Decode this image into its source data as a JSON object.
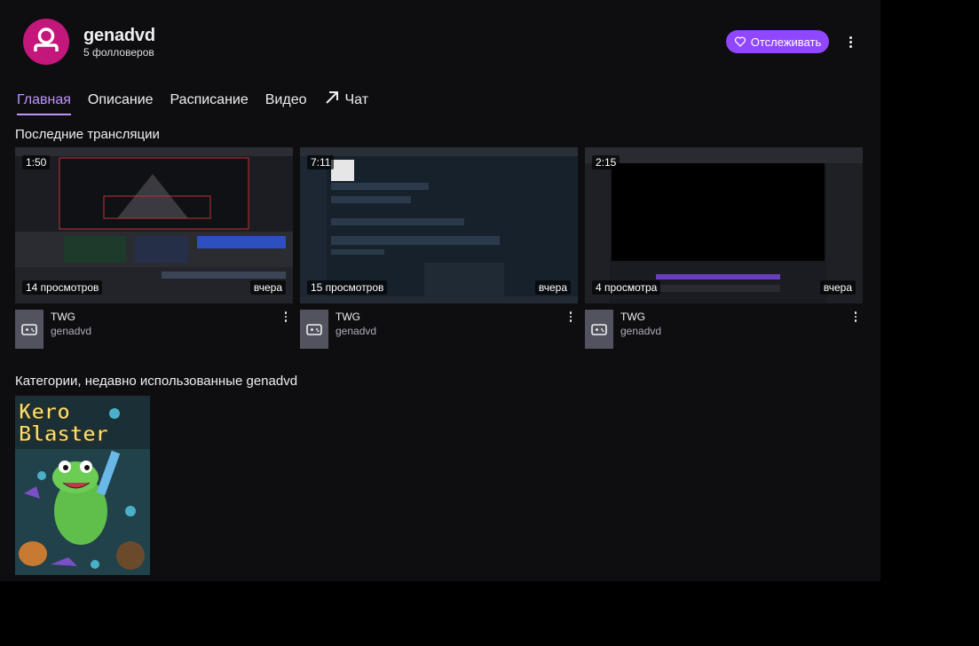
{
  "channel": {
    "name": "genadvd",
    "followers": "5 фолловеров",
    "avatar_color": "#c3177b"
  },
  "header": {
    "follow_label": "Отслеживать",
    "follow_icon": "heart-icon",
    "more_icon": "more-vertical-icon",
    "accent_color": "#9147ff"
  },
  "tabs": [
    {
      "label": "Главная",
      "active": true
    },
    {
      "label": "Описание"
    },
    {
      "label": "Расписание"
    },
    {
      "label": "Видео"
    },
    {
      "label": "Чат",
      "icon": "external-arrow-icon"
    }
  ],
  "recent": {
    "title": "Последние трансляции",
    "videos": [
      {
        "duration": "1:50",
        "views": "14 просмотров",
        "date": "вчера",
        "game": "TWG",
        "owner": "genadvd"
      },
      {
        "duration": "7:11",
        "views": "15 просмотров",
        "date": "вчера",
        "game": "TWG",
        "owner": "genadvd"
      },
      {
        "duration": "2:15",
        "views": "4 просмотра",
        "date": "вчера",
        "game": "TWG",
        "owner": "genadvd"
      }
    ]
  },
  "categories": {
    "title": "Категории, недавно использованные genadvd",
    "items": [
      {
        "box_art_text_line1": "Kero",
        "box_art_text_line2": "Blaster"
      }
    ]
  }
}
